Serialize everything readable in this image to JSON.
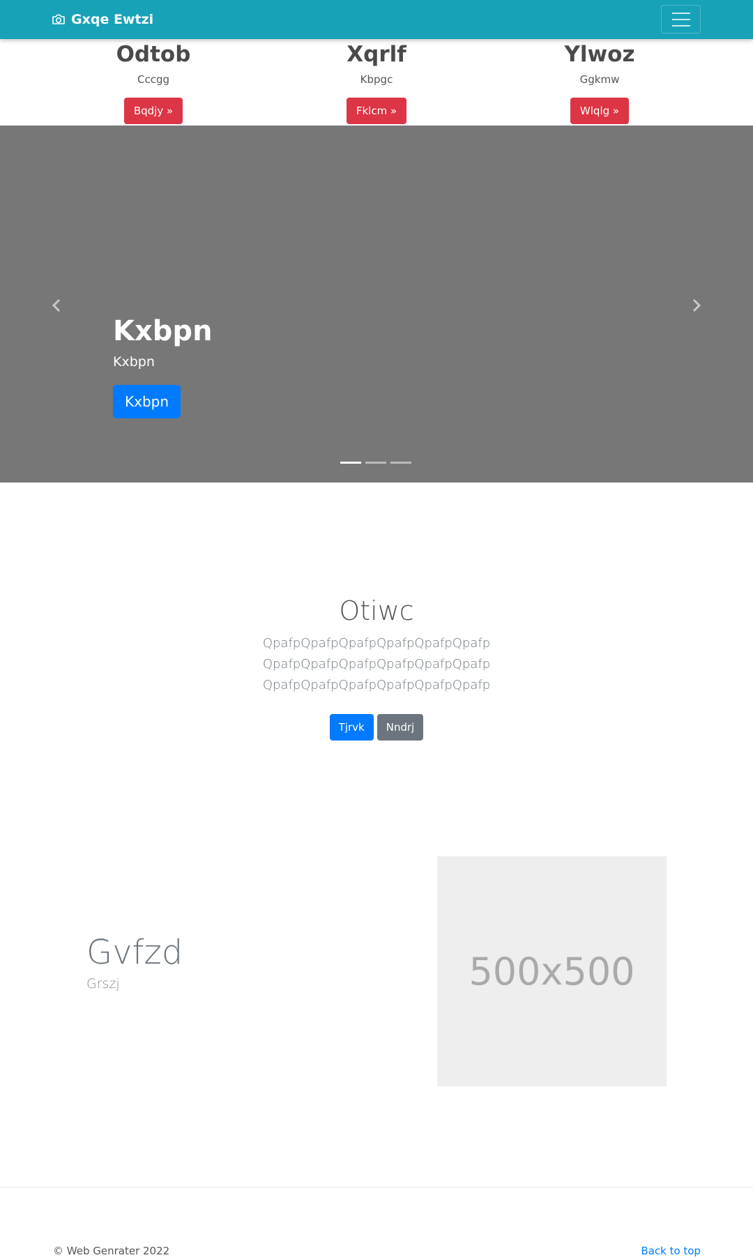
{
  "navbar": {
    "brand": "Gxqe Ewtzi",
    "brand_icon": "camera-icon",
    "toggler_icon": "hamburger-icon",
    "bg_color": "#17a2b8"
  },
  "features": [
    {
      "title": "Odtob",
      "text": "Cccgg",
      "button": "Bqdjy »"
    },
    {
      "title": "Xqrlf",
      "text": "Kbpgc",
      "button": "Fklcm »"
    },
    {
      "title": "Ylwoz",
      "text": "Ggkmw",
      "button": "Wlqlg »"
    }
  ],
  "carousel": {
    "title": "Kxbpn",
    "text": "Kxbpn",
    "button": "Kxbpn",
    "prev_icon": "chevron-left-icon",
    "next_icon": "chevron-right-icon",
    "slide_count": 3,
    "active_slide": 1
  },
  "jumbotron": {
    "title": "Otiwc",
    "lead": "QpafpQpafpQpafpQpafpQpafpQpafpQpafpQpafpQpafpQpafpQpafpQpafpQpafpQpafpQpafpQpafpQpafpQpafp",
    "primary_button": "Tjrvk",
    "secondary_button": "Nndrj"
  },
  "feature_split": {
    "heading": "Gvfzd",
    "subtext": "Grszj",
    "image_label": "500x500"
  },
  "footer": {
    "copyright": "© Web Genrater 2022",
    "back_to_top": "Back to top"
  }
}
